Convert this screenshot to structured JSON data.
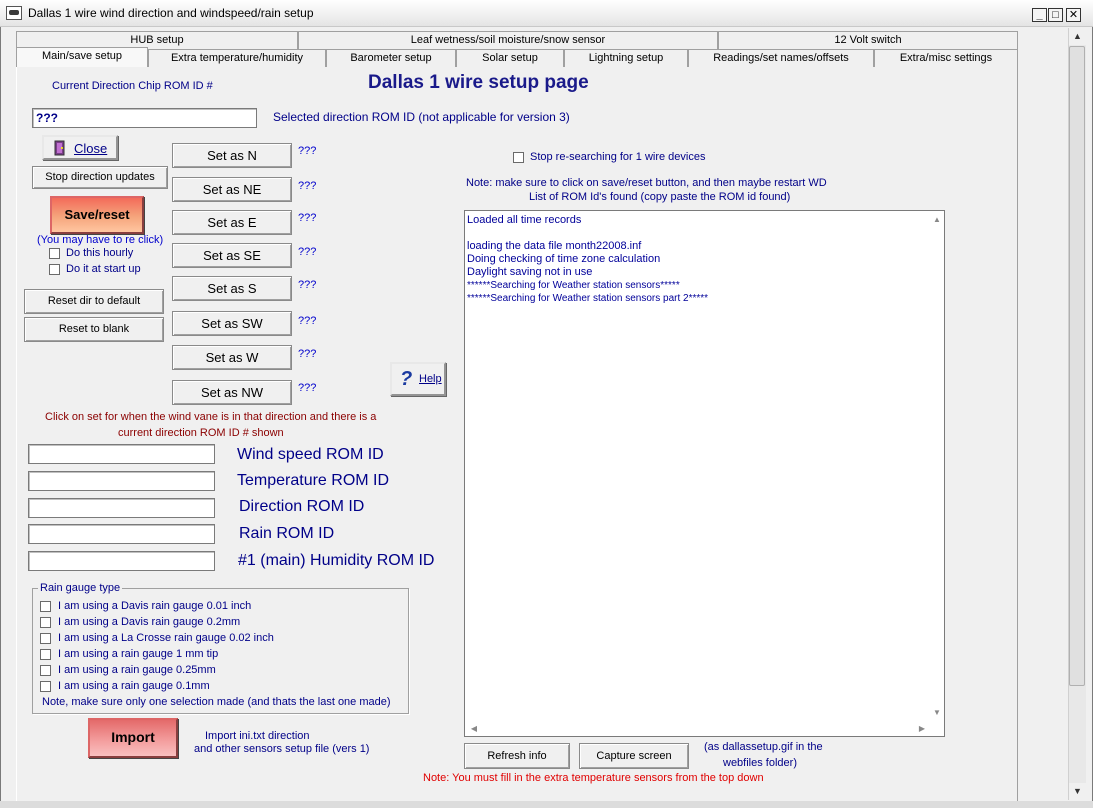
{
  "window": {
    "title": "Dallas 1 wire wind direction and windspeed/rain setup",
    "minimize": "_",
    "maximize": "□",
    "close": "✕"
  },
  "tabs": {
    "row1": [
      "HUB setup",
      "Leaf wetness/soil moisture/snow sensor",
      "12 Volt switch"
    ],
    "row2": [
      "Main/save setup",
      "Extra temperature/humidity",
      "Barometer setup",
      "Solar setup",
      "Lightning setup",
      "Readings/set names/offsets",
      "Extra/misc settings"
    ]
  },
  "main": {
    "page_title": "Dallas 1 wire setup page",
    "current_chip_label": "Current Direction Chip ROM ID #",
    "rom_id_value": "???",
    "selected_direction_label": "Selected direction ROM ID  (not applicable for version 3)",
    "close_label": "Close",
    "stop_updates_label": "Stop direction updates",
    "save_reset_label": "Save/reset",
    "reclick_note": "(You may have to re click)",
    "hourly_label": "Do this hourly",
    "startup_label": "Do it at start up",
    "reset_default_label": "Reset dir to default",
    "reset_blank_label": "Reset to blank",
    "help_label": "Help",
    "instruction_line1": "Click on set for when the wind vane is in that direction and there is a",
    "instruction_line2": "current direction ROM ID #  shown",
    "stop_research_label": "Stop re-searching for 1 wire devices",
    "note_line1": "Note: make sure to click on save/reset button, and then maybe restart WD",
    "note_line2": "List of ROM Id's found (copy paste the ROM id found)",
    "refresh_label": "Refresh info",
    "capture_label": "Capture screen",
    "capture_note_line1": "(as dallassetup.gif in the",
    "capture_note_line2": "webfiles folder)",
    "import_label": "Import",
    "import_note_line1": "Import ini.txt direction",
    "import_note_line2": "and other sensors setup file (vers 1)",
    "bottom_note": "Note: You must fill in the extra temperature sensors from the top down"
  },
  "directions": [
    {
      "label": "Set as  N",
      "value": "???"
    },
    {
      "label": "Set as NE",
      "value": "???"
    },
    {
      "label": "Set as E",
      "value": "???"
    },
    {
      "label": "Set as SE",
      "value": "???"
    },
    {
      "label": "Set as S",
      "value": "???"
    },
    {
      "label": "Set as SW",
      "value": "???"
    },
    {
      "label": "Set as W",
      "value": "???"
    },
    {
      "label": "Set as NW",
      "value": "???"
    }
  ],
  "rom_fields": [
    {
      "label": "Wind speed ROM ID",
      "value": ""
    },
    {
      "label": "Temperature ROM ID",
      "value": ""
    },
    {
      "label": "Direction ROM ID",
      "value": ""
    },
    {
      "label": "Rain ROM ID",
      "value": ""
    },
    {
      "label": "#1 (main) Humidity ROM ID",
      "value": ""
    }
  ],
  "rain_gauge": {
    "title": "Rain gauge type",
    "options": [
      "I am using a Davis rain gauge 0.01 inch",
      "I am using a Davis rain gauge 0.2mm",
      "I am using a La Crosse rain gauge 0.02 inch",
      "I am using a rain gauge 1 mm tip",
      "I am using a rain gauge 0.25mm",
      "I am using a rain gauge 0.1mm"
    ],
    "note": "Note, make sure only one selection made (and thats the last one made)"
  },
  "log_lines": [
    "Loaded all time records",
    "",
    "loading the data file month22008.inf",
    "Doing checking of time zone calculation",
    "Daylight saving not in use",
    "******Searching for Weather station sensors*****",
    "******Searching for Weather station sensors part 2*****"
  ]
}
